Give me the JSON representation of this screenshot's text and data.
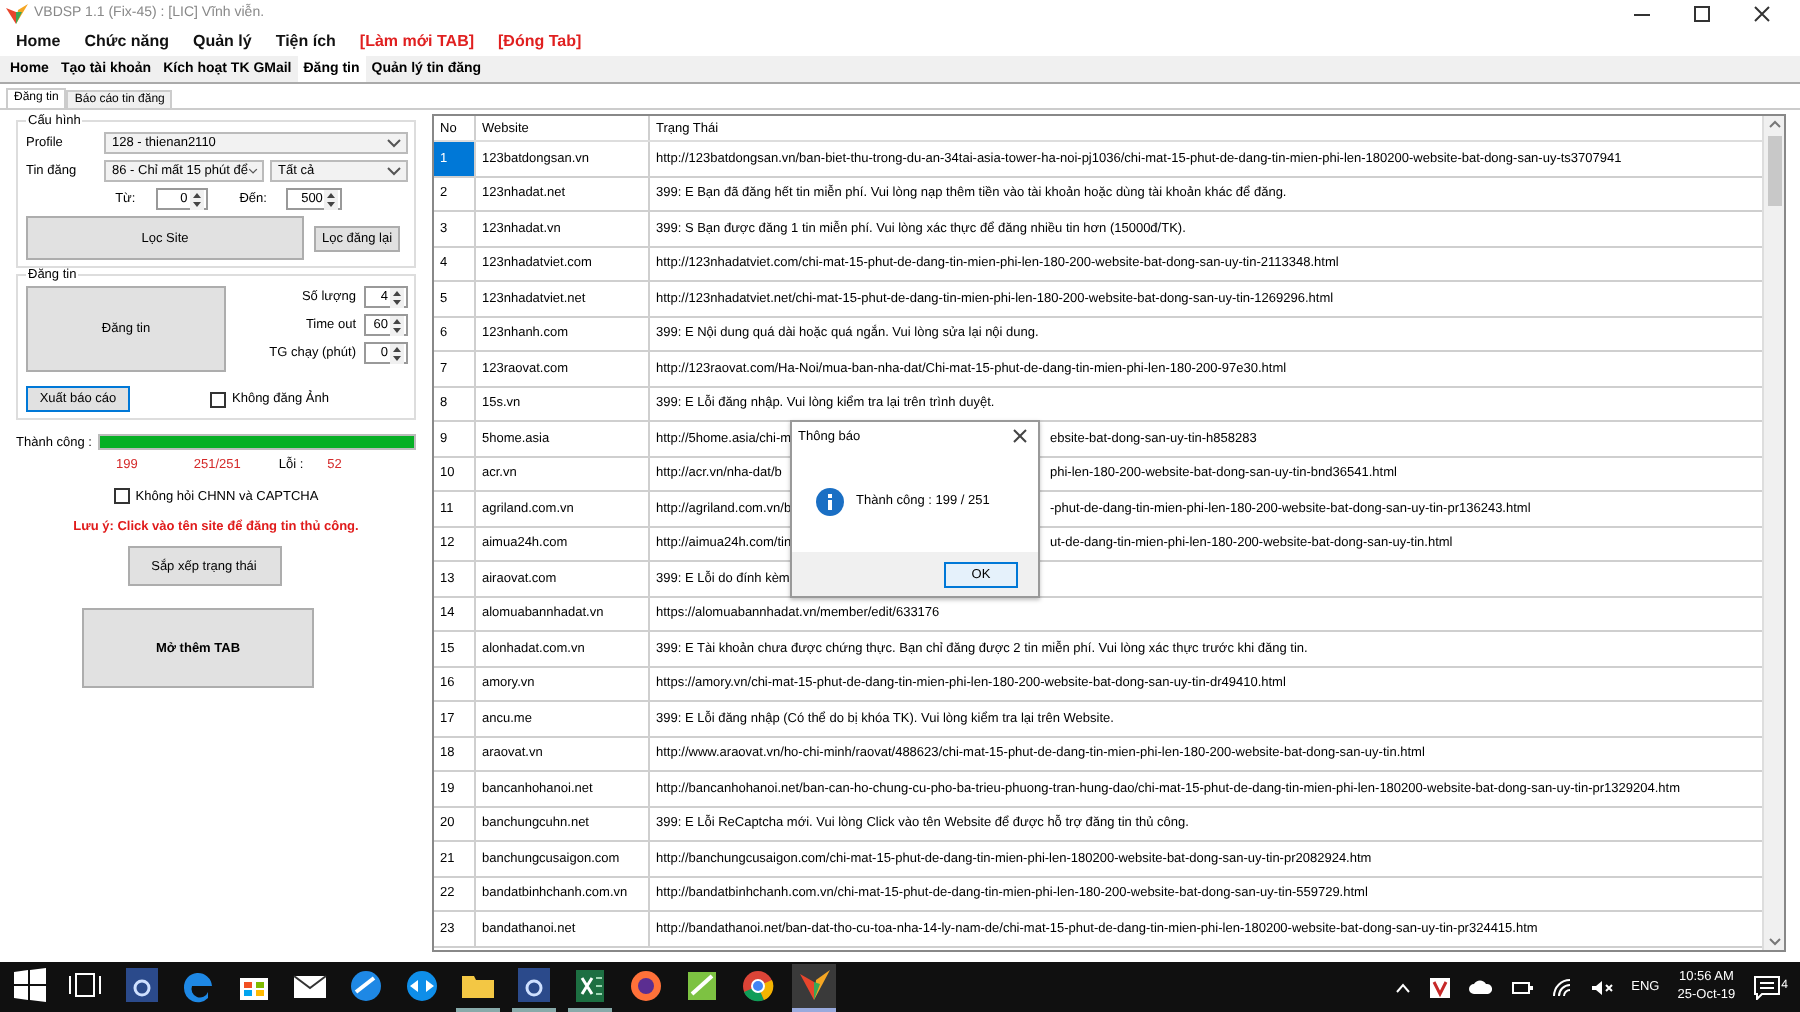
{
  "window": {
    "title": "VBDSP 1.1 (Fix-45) : [LIC] Vĩnh viễn."
  },
  "menu": [
    {
      "label": "Home",
      "kind": "menu"
    },
    {
      "label": "Chức năng",
      "kind": "menu"
    },
    {
      "label": "Quản lý",
      "kind": "menu"
    },
    {
      "label": "Tiện ích",
      "kind": "menu"
    },
    {
      "label": "[Làm mới TAB]",
      "kind": "action"
    },
    {
      "label": "[Đóng Tab]",
      "kind": "action"
    }
  ],
  "tabs": [
    {
      "label": "Home",
      "selected": false
    },
    {
      "label": "Tạo tài khoản",
      "selected": false
    },
    {
      "label": "Kích hoạt TK GMail",
      "selected": false
    },
    {
      "label": "Đăng tin",
      "selected": true
    },
    {
      "label": "Quản lý tin đăng",
      "selected": false
    }
  ],
  "subtabs": [
    {
      "label": "Đăng tin",
      "selected": true
    },
    {
      "label": "Báo cáo tin đăng",
      "selected": false
    }
  ],
  "config": {
    "title": "Cấu hình",
    "profile_label": "Profile",
    "profile": "128 - thienan2110",
    "post_label": "Tin đăng",
    "post": "86 - Chỉ mất 15 phút để",
    "category": "Tất cả",
    "from_label": "Từ:",
    "from": "0",
    "to_label": "Đến:",
    "to": "500",
    "filter_button": "Lọc Site",
    "refilter_button": "Lọc đăng lại"
  },
  "posting": {
    "title": "Đăng tin",
    "post_button": "Đăng tin",
    "fields": [
      {
        "label": "Số lượng",
        "value": "4"
      },
      {
        "label": "Time out",
        "value": "60"
      },
      {
        "label": "TG chạy (phút)",
        "value": "0"
      }
    ],
    "export_button": "Xuất báo cáo",
    "no_image": {
      "label": "Không đăng Ảnh",
      "checked": false
    }
  },
  "progress": {
    "label": "Thành công :",
    "level": 1,
    "success": "199",
    "total": "251/251",
    "error_label": "Lỗi :",
    "errors": "52"
  },
  "skip_captcha": {
    "label": "Không hỏi CHNN và CAPTCHA",
    "checked": false
  },
  "note": "Lưu ý: Click vào tên site để đăng tin thủ công.",
  "sort_button": "Sắp xếp trạng thái",
  "open_tab_button": "Mở thêm TAB",
  "table": {
    "columns": [
      "No",
      "Website",
      "Trạng Thái"
    ],
    "rows": [
      {
        "no": "1",
        "website": "123batdongsan.vn",
        "status": "http://123batdongsan.vn/ban-biet-thu-trong-du-an-34tai-asia-tower-ha-noi-pj1036/chi-mat-15-phut-de-dang-tin-mien-phi-len-180200-website-bat-dong-san-uy-ts3707941",
        "selected": true
      },
      {
        "no": "2",
        "website": "123nhadat.net",
        "status": "399: E Bạn đã đăng hết tin miễn phí. Vui lòng nạp thêm tiền vào tài khoản hoặc dùng tài khoản khác để đăng.",
        "selected": false
      },
      {
        "no": "3",
        "website": "123nhadat.vn",
        "status": "399: S Bạn được đăng 1 tin miễn phí. Vui lòng xác thực để đăng nhiều tin hơn (15000đ/TK).",
        "selected": false
      },
      {
        "no": "4",
        "website": "123nhadatviet.com",
        "status": "http://123nhadatviet.com/chi-mat-15-phut-de-dang-tin-mien-phi-len-180-200-website-bat-dong-san-uy-tin-2113348.html",
        "selected": false
      },
      {
        "no": "5",
        "website": "123nhadatviet.net",
        "status": "http://123nhadatviet.net/chi-mat-15-phut-de-dang-tin-mien-phi-len-180-200-website-bat-dong-san-uy-tin-1269296.html",
        "selected": false
      },
      {
        "no": "6",
        "website": "123nhanh.com",
        "status": "399: E Nội dung quá dài hoặc quá ngắn. Vui lòng sửa lại nội dung.",
        "selected": false
      },
      {
        "no": "7",
        "website": "123raovat.com",
        "status": "http://123raovat.com/Ha-Noi/mua-ban-nha-dat/Chi-mat-15-phut-de-dang-tin-mien-phi-len-180-200-97e30.html",
        "selected": false
      },
      {
        "no": "8",
        "website": "15s.vn",
        "status": "399: E Lỗi đăng nhập. Vui lòng kiểm tra lại trên trình duyệt.",
        "selected": false
      },
      {
        "no": "9",
        "website": "5home.asia",
        "status": "http://5home.asia/chi-m",
        "status_tail": "ebsite-bat-dong-san-uy-tin-h858283",
        "selected": false
      },
      {
        "no": "10",
        "website": "acr.vn",
        "status": "http://acr.vn/nha-dat/b",
        "status_tail": "phi-len-180-200-website-bat-dong-san-uy-tin-bnd36541.html",
        "selected": false
      },
      {
        "no": "11",
        "website": "agriland.com.vn",
        "status": "http://agriland.com.vn/b",
        "status_tail": "-phut-de-dang-tin-mien-phi-len-180-200-website-bat-dong-san-uy-tin-pr136243.html",
        "selected": false
      },
      {
        "no": "12",
        "website": "aimua24h.com",
        "status": "http://aimua24h.com/tin",
        "status_tail": "ut-de-dang-tin-mien-phi-len-180-200-website-bat-dong-san-uy-tin.html",
        "selected": false
      },
      {
        "no": "13",
        "website": "airaovat.com",
        "status": "399: E Lỗi do đính kèm",
        "selected": false
      },
      {
        "no": "14",
        "website": "alomuabannhadat.vn",
        "status": "https://alomuabannhadat.vn/member/edit/633176",
        "selected": false
      },
      {
        "no": "15",
        "website": "alonhadat.com.vn",
        "status": "399: E Tài khoản chưa được chứng thực. Bạn chỉ đăng được 2 tin miễn phí. Vui lòng xác thực trước khi đăng tin.",
        "selected": false
      },
      {
        "no": "16",
        "website": "amory.vn",
        "status": "https://amory.vn/chi-mat-15-phut-de-dang-tin-mien-phi-len-180-200-website-bat-dong-san-uy-tin-dr49410.html",
        "selected": false
      },
      {
        "no": "17",
        "website": "ancu.me",
        "status": "399: E Lỗi đăng nhập (Có thể do bị khóa TK). Vui lòng kiểm tra lại trên Website.",
        "selected": false
      },
      {
        "no": "18",
        "website": "araovat.vn",
        "status": "http://www.araovat.vn/ho-chi-minh/raovat/488623/chi-mat-15-phut-de-dang-tin-mien-phi-len-180-200-website-bat-dong-san-uy-tin.html",
        "selected": false
      },
      {
        "no": "19",
        "website": "bancanhohanoi.net",
        "status": "http://bancanhohanoi.net/ban-can-ho-chung-cu-pho-ba-trieu-phuong-tran-hung-dao/chi-mat-15-phut-de-dang-tin-mien-phi-len-180200-website-bat-dong-san-uy-tin-pr1329204.htm",
        "selected": false
      },
      {
        "no": "20",
        "website": "banchungcuhn.net",
        "status": "399: E Lỗi ReCaptcha mới. Vui lòng Click vào tên Website để được hỗ trợ đăng tin thủ công.",
        "selected": false
      },
      {
        "no": "21",
        "website": "banchungcusaigon.com",
        "status": "http://banchungcusaigon.com/chi-mat-15-phut-de-dang-tin-mien-phi-len-180200-website-bat-dong-san-uy-tin-pr2082924.htm",
        "selected": false
      },
      {
        "no": "22",
        "website": "bandatbinhchanh.com.vn",
        "status": "http://bandatbinhchanh.com.vn/chi-mat-15-phut-de-dang-tin-mien-phi-len-180-200-website-bat-dong-san-uy-tin-559729.html",
        "selected": false
      },
      {
        "no": "23",
        "website": "bandathanoi.net",
        "status": "http://bandathanoi.net/ban-dat-tho-cu-toa-nha-14-ly-nam-de/chi-mat-15-phut-de-dang-tin-mien-phi-len-180200-website-bat-dong-san-uy-tin-pr324415.htm",
        "selected": false
      }
    ]
  },
  "dialog": {
    "title": "Thông báo",
    "message": "Thành công : 199 / 251",
    "button": "OK"
  },
  "taskbar": {
    "language": "ENG",
    "time": "10:56 AM",
    "date": "25-Oct-19",
    "notifications": "4"
  }
}
